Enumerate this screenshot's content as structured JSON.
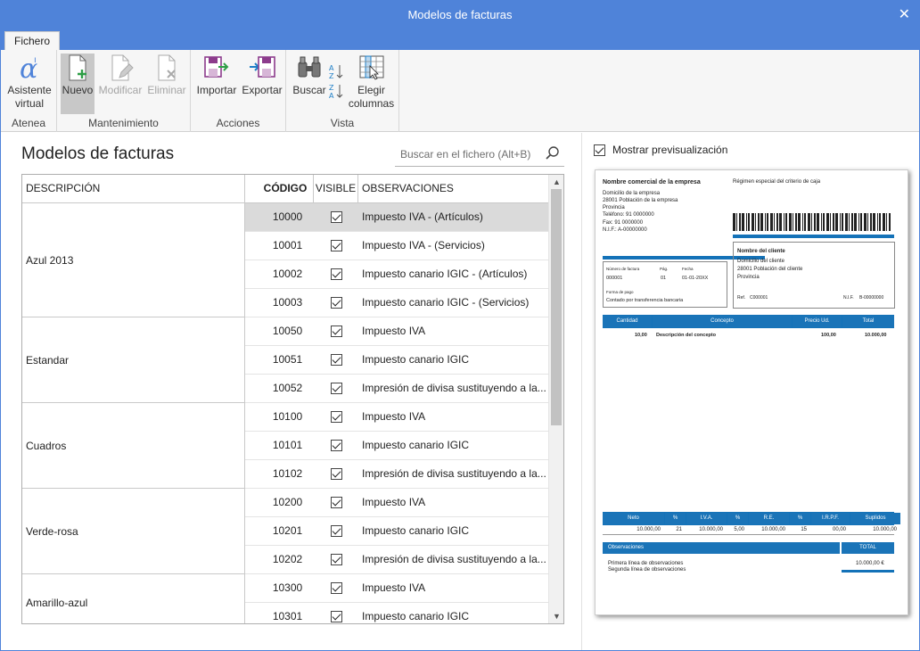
{
  "window": {
    "title": "Modelos de facturas",
    "close_glyph": "✕"
  },
  "tab": {
    "label": "Fichero"
  },
  "ribbon": {
    "groups": [
      {
        "label": "Atenea",
        "buttons": [
          {
            "label1": "Asistente",
            "label2": "virtual",
            "icon": "alpha-icon"
          }
        ]
      },
      {
        "label": "Mantenimiento",
        "buttons": [
          {
            "label": "Nuevo",
            "icon": "new-document-icon"
          },
          {
            "label": "Modificar",
            "icon": "edit-document-icon"
          },
          {
            "label": "Eliminar",
            "icon": "delete-document-icon"
          }
        ]
      },
      {
        "label": "Acciones",
        "buttons": [
          {
            "label": "Importar",
            "icon": "import-icon"
          },
          {
            "label": "Exportar",
            "icon": "export-icon"
          }
        ]
      },
      {
        "label": "Vista",
        "buttons": [
          {
            "label": "Buscar",
            "icon": "binoculars-icon"
          },
          {
            "label1": "Elegir",
            "label2": "columnas",
            "icon": "columns-icon"
          }
        ]
      }
    ]
  },
  "main": {
    "title": "Modelos de facturas",
    "search_placeholder": "Buscar en el fichero (Alt+B)"
  },
  "grid": {
    "headers": {
      "descripcion": "DESCRIPCIÓN",
      "codigo": "CÓDIGO",
      "visible": "VISIBLE",
      "observaciones": "OBSERVACIONES"
    },
    "groups": [
      {
        "desc": "Azul 2013",
        "rows": [
          {
            "code": "10000",
            "visible": true,
            "obs": "Impuesto IVA - (Artículos)"
          },
          {
            "code": "10001",
            "visible": true,
            "obs": "Impuesto IVA - (Servicios)"
          },
          {
            "code": "10002",
            "visible": true,
            "obs": "Impuesto canario IGIC - (Artículos)"
          },
          {
            "code": "10003",
            "visible": true,
            "obs": "Impuesto canario IGIC - (Servicios)"
          }
        ]
      },
      {
        "desc": "Estandar",
        "rows": [
          {
            "code": "10050",
            "visible": true,
            "obs": "Impuesto IVA"
          },
          {
            "code": "10051",
            "visible": true,
            "obs": "Impuesto canario IGIC"
          },
          {
            "code": "10052",
            "visible": true,
            "obs": "Impresión de divisa sustituyendo a la..."
          }
        ]
      },
      {
        "desc": "Cuadros",
        "rows": [
          {
            "code": "10100",
            "visible": true,
            "obs": "Impuesto IVA"
          },
          {
            "code": "10101",
            "visible": true,
            "obs": "Impuesto canario IGIC"
          },
          {
            "code": "10102",
            "visible": true,
            "obs": "Impresión de divisa sustituyendo a la..."
          }
        ]
      },
      {
        "desc": "Verde-rosa",
        "rows": [
          {
            "code": "10200",
            "visible": true,
            "obs": "Impuesto IVA"
          },
          {
            "code": "10201",
            "visible": true,
            "obs": "Impuesto canario IGIC"
          },
          {
            "code": "10202",
            "visible": true,
            "obs": "Impresión de divisa sustituyendo a la..."
          }
        ]
      },
      {
        "desc": "Amarillo-azul",
        "rows": [
          {
            "code": "10300",
            "visible": true,
            "obs": "Impuesto IVA"
          },
          {
            "code": "10301",
            "visible": true,
            "obs": "Impuesto canario IGIC"
          }
        ]
      }
    ]
  },
  "preview": {
    "checkbox_label": "Mostrar previsualización",
    "checked": true,
    "doc": {
      "company": "Nombre comercial de la empresa",
      "regime": "Régimen especial del criterio de caja",
      "address": "Domicilio de la empresa",
      "city": "28001    Población de la empresa",
      "province": "Provincia",
      "phone": "Teléfono:   91 0000000",
      "fax": "Fax:   91 0000000",
      "nif": "N.I.F.: A-00000000",
      "client_title": "Nombre del cliente",
      "client_address": "Domicilio del cliente",
      "client_city": "28001 Población del cliente",
      "client_province": "Provincia",
      "ref_label": "Ref.",
      "ref_value": "C000001",
      "nif_label": "N.I.F.",
      "nif_value": "B-00000000",
      "inv_num_label": "Número de factura",
      "inv_num": "000001",
      "page_label": "Pág.",
      "page": "01",
      "date_label": "Fecha",
      "date": "01-01-20XX",
      "pay_label": "Forma de pago",
      "pay": "Contado por transferencia bancaria",
      "cols": [
        "Cantidad",
        "Concepto",
        "Precio Ud.",
        "Total"
      ],
      "line": {
        "qty": "10,00",
        "concept": "Descripción del concepto",
        "price": "100,00",
        "total": "10.000,00"
      },
      "totals_cols": [
        "Neto",
        "%",
        "I.V.A.",
        "%",
        "R.E.",
        "%",
        "I.R.P.F.",
        "Suplidos"
      ],
      "totals_vals": [
        "10.000,00",
        "21",
        "10.000,00",
        "5,00",
        "10.000,00",
        "15",
        "00,00",
        "10.000,00"
      ],
      "obs_label": "Observaciones",
      "total_label": "TOTAL",
      "obs1": "Primera línea de observaciones",
      "obs2": "Segunda línea de observaciones",
      "total_value": "10.000,00 €"
    }
  },
  "colors": {
    "titlebar": "#4f83d9",
    "accent_doc": "#1a74b8",
    "selected_row": "#dadada"
  }
}
